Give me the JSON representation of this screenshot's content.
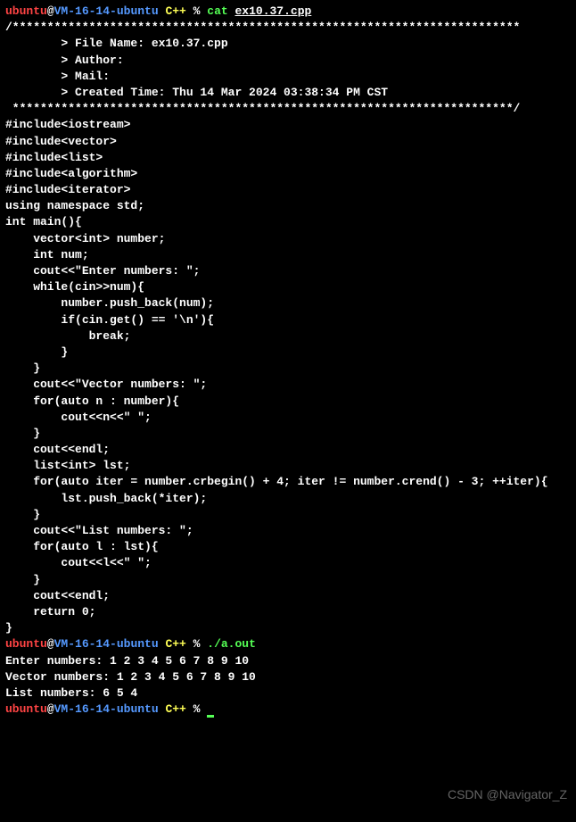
{
  "prompt1": {
    "user": "ubuntu",
    "at": "@",
    "host": "VM-16-14-ubuntu",
    "dir": " C++",
    "pct": " % ",
    "cmd": "cat ",
    "arg": "ex10.37.cpp"
  },
  "src": {
    "l01": "/*************************************************************************",
    "l02": "        > File Name: ex10.37.cpp",
    "l03": "        > Author:",
    "l04": "        > Mail:",
    "l05": "        > Created Time: Thu 14 Mar 2024 03:38:34 PM CST",
    "l06": " ************************************************************************/",
    "l07": "",
    "l08": "#include<iostream>",
    "l09": "#include<vector>",
    "l10": "#include<list>",
    "l11": "#include<algorithm>",
    "l12": "#include<iterator>",
    "l13": "using namespace std;",
    "l14": "",
    "l15": "int main(){",
    "l16": "    vector<int> number;",
    "l17": "    int num;",
    "l18": "    cout<<\"Enter numbers: \";",
    "l19": "    while(cin>>num){",
    "l20": "        number.push_back(num);",
    "l21": "        if(cin.get() == '\\n'){",
    "l22": "            break;",
    "l23": "        }",
    "l24": "    }",
    "l25": "",
    "l26": "    cout<<\"Vector numbers: \";",
    "l27": "    for(auto n : number){",
    "l28": "        cout<<n<<\" \";",
    "l29": "    }",
    "l30": "    cout<<endl;",
    "l31": "",
    "l32": "    list<int> lst;",
    "l33": "    for(auto iter = number.crbegin() + 4; iter != number.crend() - 3; ++iter){",
    "l34": "        lst.push_back(*iter);",
    "l35": "    }",
    "l36": "    cout<<\"List numbers: \";",
    "l37": "    for(auto l : lst){",
    "l38": "        cout<<l<<\" \";",
    "l39": "    }",
    "l40": "    cout<<endl;",
    "l41": "",
    "l42": "    return 0;",
    "l43": "",
    "l44": "}"
  },
  "prompt2": {
    "user": "ubuntu",
    "at": "@",
    "host": "VM-16-14-ubuntu",
    "dir": " C++",
    "pct": " % ",
    "cmd": "./a.out"
  },
  "out": {
    "l1": "Enter numbers: 1 2 3 4 5 6 7 8 9 10",
    "l2": "Vector numbers: 1 2 3 4 5 6 7 8 9 10",
    "l3": "List numbers: 6 5 4"
  },
  "prompt3": {
    "user": "ubuntu",
    "at": "@",
    "host": "VM-16-14-ubuntu",
    "dir": " C++",
    "pct": " % "
  },
  "watermark": "CSDN @Navigator_Z"
}
